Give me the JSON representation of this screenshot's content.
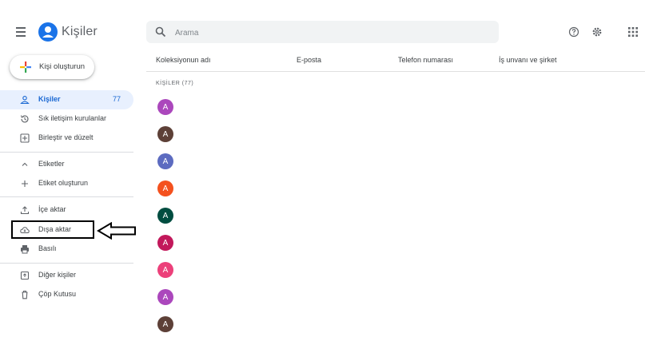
{
  "app": {
    "title": "Kişiler",
    "accent_color": "#1a73e8"
  },
  "search": {
    "placeholder": "Arama",
    "value": ""
  },
  "header_icons": [
    "help-icon",
    "settings-icon",
    "apps-grid-icon"
  ],
  "create_button": {
    "label": "Kişi oluşturun"
  },
  "sidebar": {
    "items": [
      {
        "label": "Kişiler",
        "count": "77",
        "icon": "person-icon",
        "active": true
      },
      {
        "label": "Sık iletişim kurulanlar",
        "icon": "history-icon"
      },
      {
        "label": "Birleştir ve düzelt",
        "icon": "merge-icon"
      },
      {
        "label": "Etiketler",
        "icon": "chevron-up-icon"
      },
      {
        "label": "Etiket oluşturun",
        "icon": "plus-icon"
      },
      {
        "label": "İçe aktar",
        "icon": "upload-icon"
      },
      {
        "label": "Dışa aktar",
        "icon": "cloud-download-icon"
      },
      {
        "label": "Basılı",
        "icon": "print-icon"
      },
      {
        "label": "Diğer kişiler",
        "icon": "other-contacts-icon"
      },
      {
        "label": "Çöp Kutusu",
        "icon": "trash-icon"
      }
    ]
  },
  "table": {
    "columns": [
      "Koleksiyonun adı",
      "E-posta",
      "Telefon numarası",
      "İş unvanı ve şirket"
    ],
    "section_label": "KİŞİLER (77)",
    "contacts": [
      {
        "initial": "A",
        "color": "#ab47bc"
      },
      {
        "initial": "A",
        "color": "#5d4037"
      },
      {
        "initial": "A",
        "color": "#5c6bc0"
      },
      {
        "initial": "A",
        "color": "#f4511e"
      },
      {
        "initial": "A",
        "color": "#004d40"
      },
      {
        "initial": "A",
        "color": "#c2185b"
      },
      {
        "initial": "A",
        "color": "#ec407a"
      },
      {
        "initial": "A",
        "color": "#ab47bc"
      },
      {
        "initial": "A",
        "color": "#5d4037"
      }
    ]
  }
}
